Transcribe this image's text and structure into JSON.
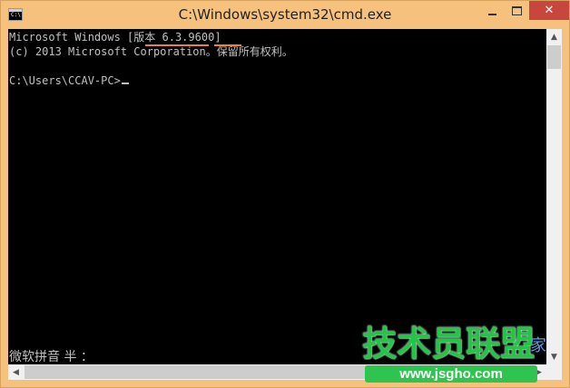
{
  "window": {
    "title": "C:\\Windows\\system32\\cmd.exe",
    "controls": {
      "close_icon": "close-icon",
      "maximize_icon": "maximize-icon",
      "minimize_icon": "minimize-icon"
    }
  },
  "console": {
    "line1_prefix": "Microsoft Windows [",
    "line1_version": "版本 6.3.9600",
    "line1_suffix": "]",
    "line2": "(c) 2013 Microsoft Corporation。保留所有权利。",
    "prompt": "C:\\Users\\CCAV-PC>",
    "ime_status": "微软拼音 半 ："
  },
  "watermark": {
    "brand": "技术员联盟",
    "brand_suffix": "家",
    "url": "www.jsgho.com"
  },
  "colors": {
    "titlebar": "#f5c17d",
    "console_bg": "#000000",
    "console_text": "#c0c0c0",
    "annotation_underline": "#e9823a",
    "close_button": "#c7463d"
  }
}
